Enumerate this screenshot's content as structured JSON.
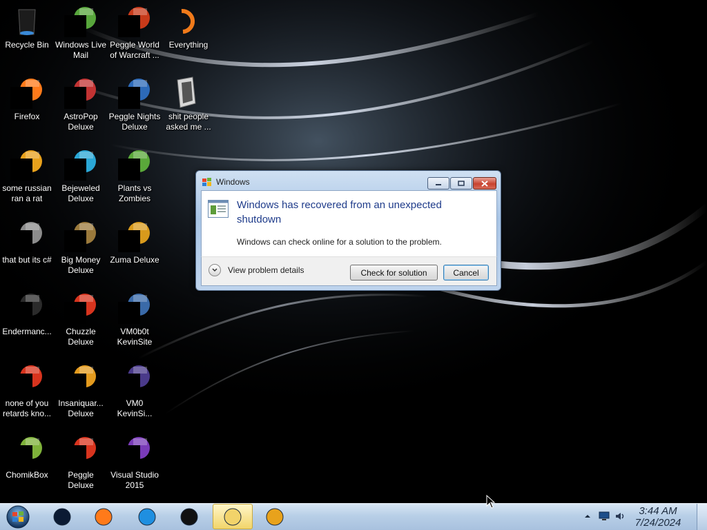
{
  "desktop": {
    "icons": [
      {
        "label": "Recycle Bin",
        "icon": "recycle-bin-icon",
        "color": "#1c1c1c",
        "redacted": false
      },
      {
        "label": "Firefox",
        "icon": "firefox-icon",
        "color": "#ff7a1a",
        "redacted": true
      },
      {
        "label": "some russian\nran a rat",
        "icon": "notepad-e-icon",
        "color": "#e8a11c",
        "redacted": true
      },
      {
        "label": "that but its c#",
        "icon": "folder-stack-icon",
        "color": "#8c8c8c",
        "redacted": true
      },
      {
        "label": "Endermanc...",
        "icon": "console-icon",
        "color": "#2b2b2b",
        "redacted": true
      },
      {
        "label": "none of you\nretards kno...",
        "icon": "peggle-icon",
        "color": "#d8341e",
        "redacted": true
      },
      {
        "label": "ChomikBox",
        "icon": "chomikbox-icon",
        "color": "#7fb23a",
        "redacted": true
      },
      {
        "label": "Windows Live\nMail",
        "icon": "mail-icon",
        "color": "#58a63c",
        "redacted": true
      },
      {
        "label": "AstroPop\nDeluxe",
        "icon": "astropop-icon",
        "color": "#c23333",
        "redacted": true
      },
      {
        "label": "Bejeweled\nDeluxe",
        "icon": "bejeweled-icon",
        "color": "#2aa7d6",
        "redacted": true
      },
      {
        "label": "Big Money\nDeluxe",
        "icon": "money-bag-icon",
        "color": "#9b7a3c",
        "redacted": true
      },
      {
        "label": "Chuzzle\nDeluxe",
        "icon": "chuzzle-icon",
        "color": "#d8341e",
        "redacted": true
      },
      {
        "label": "Insaniquar...\nDeluxe",
        "icon": "fish-icon",
        "color": "#e49b1e",
        "redacted": true
      },
      {
        "label": "Peggle Deluxe",
        "icon": "peggle-icon",
        "color": "#d8341e",
        "redacted": true
      },
      {
        "label": "Peggle World\nof Warcraft ...",
        "icon": "peggle-icon",
        "color": "#c83a1a",
        "redacted": true
      },
      {
        "label": "Peggle Nights\nDeluxe",
        "icon": "peggle-nights-icon",
        "color": "#2d6ab8",
        "redacted": true
      },
      {
        "label": "Plants vs\nZombies",
        "icon": "plant-icon",
        "color": "#5aa83a",
        "redacted": true
      },
      {
        "label": "Zuma Deluxe",
        "icon": "zuma-icon",
        "color": "#d89a1c",
        "redacted": true
      },
      {
        "label": "VM0b0t\nKevinSite",
        "icon": "vm-icon",
        "color": "#3a6aa8",
        "redacted": true
      },
      {
        "label": "VM0\nKevinSi...",
        "icon": "vm-file-icon",
        "color": "#4a3a8a",
        "redacted": true
      },
      {
        "label": "Visual Studio\n2015",
        "icon": "visual-studio-icon",
        "color": "#7a3bb8",
        "redacted": true
      },
      {
        "label": "Everything",
        "icon": "everything-icon",
        "color": "#f07a1a",
        "redacted": false
      },
      {
        "label": "shit people\nasked me ...",
        "icon": "folder-icon",
        "color": "#a0a0a0",
        "redacted": false
      }
    ]
  },
  "dialog": {
    "title": "Windows",
    "headline": "Windows has recovered from an unexpected shutdown",
    "message": "Windows can check online for a solution to the problem.",
    "details_label": "View problem details",
    "check_button": "Check for solution",
    "cancel_button": "Cancel"
  },
  "taskbar": {
    "items": [
      {
        "name": "taskbar-media-icon",
        "active": false
      },
      {
        "name": "taskbar-firefox-icon",
        "active": false
      },
      {
        "name": "taskbar-internet-explorer-icon",
        "active": false
      },
      {
        "name": "taskbar-black-box-icon",
        "active": false
      },
      {
        "name": "taskbar-game-icon",
        "active": true
      },
      {
        "name": "taskbar-media-player-icon",
        "active": false
      }
    ],
    "clock": {
      "time": "3:44 AM",
      "date": "7/24/2024"
    }
  },
  "colors": {
    "headline": "#1e3b8a",
    "taskbar": "#b8cfe7",
    "accent_close": "#c8432f"
  }
}
